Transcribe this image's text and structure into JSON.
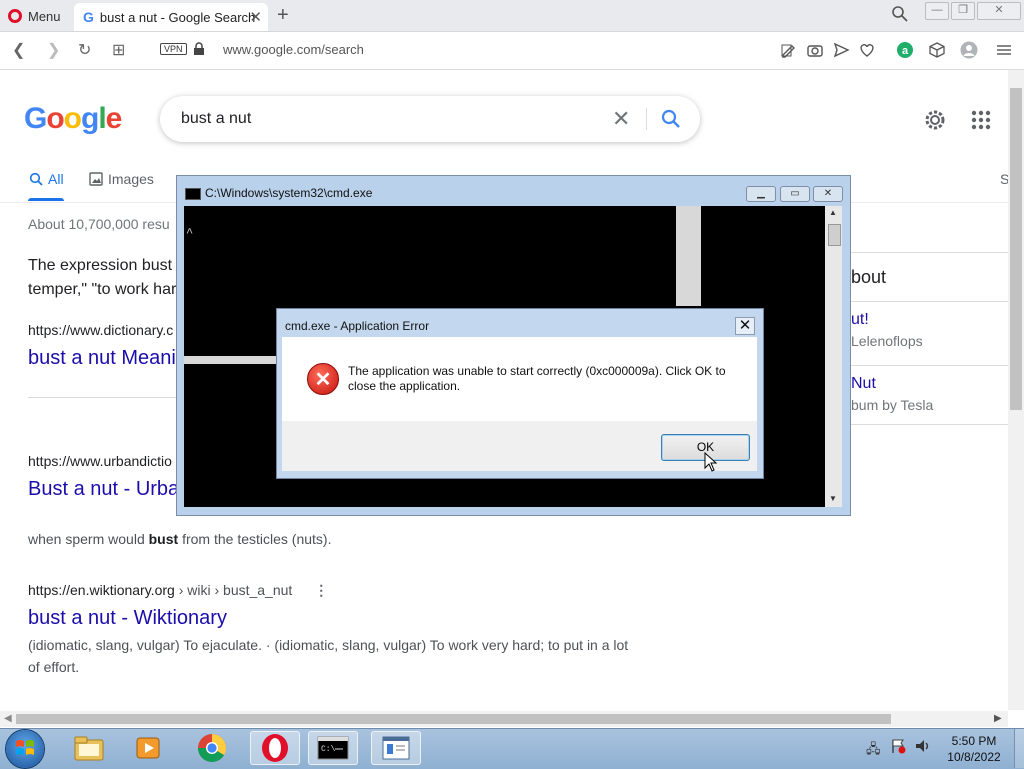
{
  "browser": {
    "menu_label": "Menu",
    "tab_title": "bust a nut - Google Search",
    "url": "www.google.com/search",
    "vpn_label": "VPN"
  },
  "google": {
    "logo": "Google",
    "query": "bust a nut",
    "tabs": {
      "all": "All",
      "images": "Images",
      "s": "S"
    },
    "result_stats": "About 10,700,000 resu",
    "snippet_line1": "The expression bust",
    "snippet_line2": "temper,\" \"to work har",
    "results": [
      {
        "url": "https://www.dictionary.c",
        "title": "bust a nut Meani"
      },
      {
        "url": "https://www.urbandictio",
        "title": "Bust a nut - Urba",
        "desc_pre": "when sperm would ",
        "desc_bold": "bust",
        "desc_post": " from the testicles (nuts)."
      },
      {
        "url_domain": "https://en.wiktionary.org",
        "url_path": " › wiki › bust_a_nut",
        "title": "bust a nut - Wiktionary",
        "desc": "(idiomatic, slang, vulgar) To ejaculate. · (idiomatic, slang, vulgar) To work very hard; to put in a lot of effort."
      }
    ],
    "knowledge_panel": {
      "about": "bout",
      "item1_title": "ut!",
      "item1_sub": "Lelenoflops",
      "item2_title": "Nut",
      "item2_sub": "bum by Tesla"
    }
  },
  "cmd_window": {
    "title": "C:\\Windows\\system32\\cmd.exe",
    "cursor_char": "^"
  },
  "error_dialog": {
    "title": "cmd.exe - Application Error",
    "message": "The application was unable to start correctly (0xc000009a). Click OK to close the application.",
    "ok_label": "OK"
  },
  "taskbar": {
    "time": "5:50 PM",
    "date": "10/8/2022"
  },
  "colors": {
    "link": "#1a0dab",
    "accent_blue": "#1a73e8",
    "error_red": "#c5120c",
    "opera_red": "#e0102b"
  }
}
